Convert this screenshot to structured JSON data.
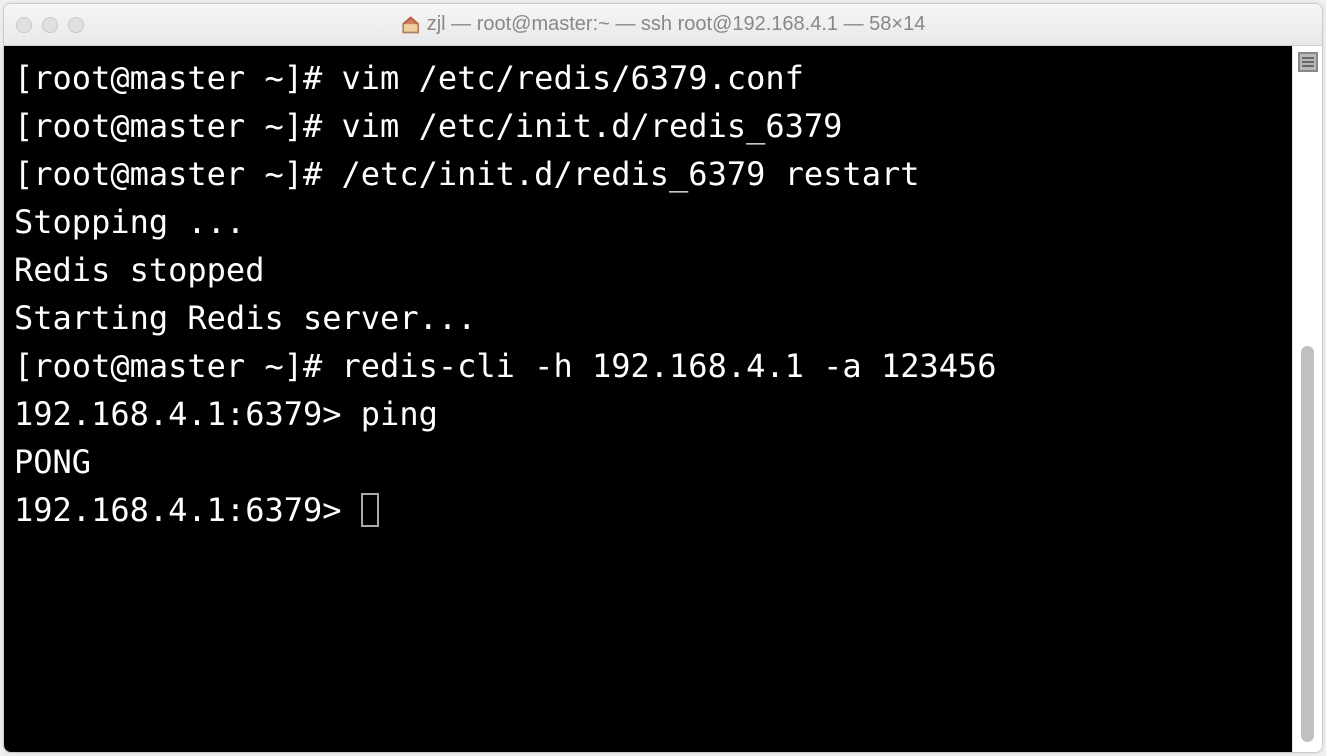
{
  "window": {
    "title": "zjl — root@master:~ — ssh root@192.168.4.1 — 58×14"
  },
  "terminal": {
    "lines": [
      "[root@master ~]# vim /etc/redis/6379.conf",
      "[root@master ~]# vim /etc/init.d/redis_6379",
      "[root@master ~]# /etc/init.d/redis_6379 restart",
      "Stopping ...",
      "Redis stopped",
      "Starting Redis server...",
      "[root@master ~]# redis-cli -h 192.168.4.1 -a 123456",
      "192.168.4.1:6379> ping",
      "PONG",
      "192.168.4.1:6379> "
    ]
  }
}
